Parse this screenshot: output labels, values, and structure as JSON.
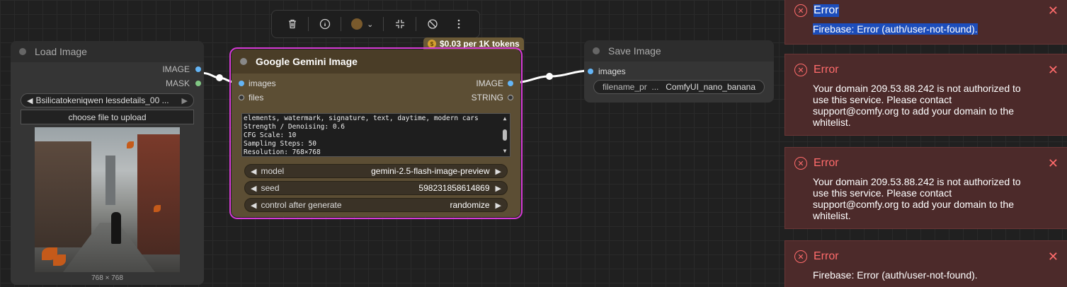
{
  "toolbar": {
    "icons": [
      "trash-icon",
      "info-icon",
      "color-picker",
      "collapse-icon",
      "bypass-icon",
      "more-icon"
    ],
    "node_color": "#7a5a2c"
  },
  "load_image": {
    "title": "Load Image",
    "outputs": [
      {
        "label": "IMAGE",
        "color": "#64b5f6"
      },
      {
        "label": "MASK",
        "color": "#81c784"
      }
    ],
    "file_value": "Bsilicatokeniqwen lessdetails_00 ...",
    "upload_label": "choose file to upload",
    "image_size": "768 × 768"
  },
  "gemini": {
    "title": "Google Gemini Image",
    "price": "$0.03 per 1K tokens",
    "inputs": [
      "images",
      "files"
    ],
    "outputs": [
      "IMAGE",
      "STRING"
    ],
    "prompt_lines": [
      "elements, watermark, signature, text, daytime, modern cars",
      "Strength / Denoising: 0.6",
      "CFG Scale: 10",
      "Sampling Steps: 50",
      "Resolution: 768×768"
    ],
    "widgets": [
      {
        "label": "model",
        "value": "gemini-2.5-flash-image-preview"
      },
      {
        "label": "seed",
        "value": "598231858614869"
      },
      {
        "label": "control after generate",
        "value": "randomize"
      }
    ],
    "accent": "#d63ad6"
  },
  "save_image": {
    "title": "Save Image",
    "input": "images",
    "filename_label": "filename_pr",
    "filename_ellipsis": "...",
    "filename_value": "ComfyUI_nano_banana"
  },
  "toasts": [
    {
      "title": "Error",
      "message": "Firebase: Error (auth/user-not-found)."
    },
    {
      "title": "Error",
      "message": "Your domain 209.53.88.242 is not authorized to use this service. Please contact support@comfy.org to add your domain to the whitelist."
    },
    {
      "title": "Error",
      "message": "Your domain 209.53.88.242 is not authorized to use this service. Please contact support@comfy.org to add your domain to the whitelist."
    },
    {
      "title": "Error",
      "message": "Firebase: Error (auth/user-not-found)."
    }
  ]
}
